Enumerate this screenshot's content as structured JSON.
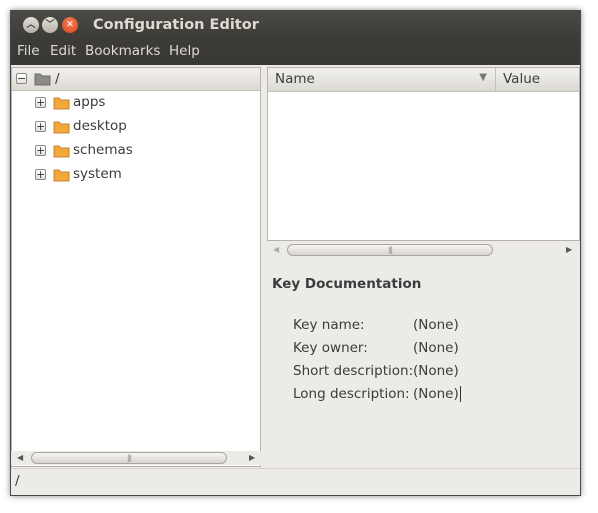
{
  "window": {
    "title": "Configuration Editor"
  },
  "menu": [
    "File",
    "Edit",
    "Bookmarks",
    "Help"
  ],
  "tree": {
    "root_label": "/",
    "root_expander": "−",
    "items": [
      {
        "label": "apps",
        "expander": "+"
      },
      {
        "label": "desktop",
        "expander": "+"
      },
      {
        "label": "schemas",
        "expander": "+"
      },
      {
        "label": "system",
        "expander": "+"
      }
    ]
  },
  "list": {
    "columns": [
      "Name",
      "Value"
    ],
    "sort_indicator": "▼"
  },
  "doc": {
    "title": "Key Documentation",
    "fields": [
      {
        "label": "Key name:",
        "value": "(None)"
      },
      {
        "label": "Key owner:",
        "value": "(None)"
      },
      {
        "label": "Short description:",
        "value": "(None)"
      },
      {
        "label": "Long description:",
        "value": "(None)"
      }
    ]
  },
  "status": {
    "path": "/"
  },
  "colors": {
    "titlebar": "#3c3b37",
    "close_button": "#e05a2b",
    "folder": "#f2a93b"
  }
}
